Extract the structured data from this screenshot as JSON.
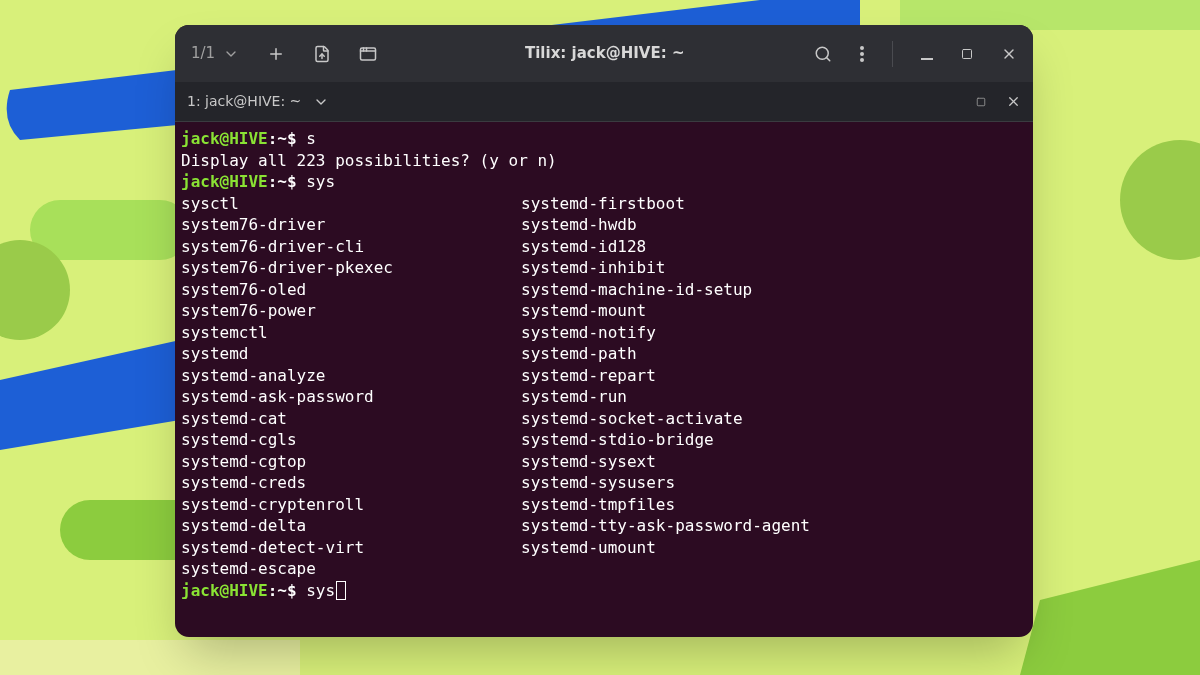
{
  "window": {
    "title": "Tilix: jack@HIVE: ~",
    "session_counter": "1/1"
  },
  "terminal_tab": {
    "title": "1: jack@HIVE: ~"
  },
  "terminal": {
    "lines": [
      {
        "kind": "prompt",
        "user_host": "jack@HIVE",
        "path": ":~$",
        "command": "s",
        "cursor": false
      },
      {
        "kind": "output",
        "text": "Display all 223 possibilities? (y or n)"
      },
      {
        "kind": "prompt",
        "user_host": "jack@HIVE",
        "path": ":~$",
        "command": "sys",
        "cursor": false
      }
    ],
    "completions": {
      "column_1": [
        "sysctl",
        "system76-driver",
        "system76-driver-cli",
        "system76-driver-pkexec",
        "system76-oled",
        "system76-power",
        "systemctl",
        "systemd",
        "systemd-analyze",
        "systemd-ask-password",
        "systemd-cat",
        "systemd-cgls",
        "systemd-cgtop",
        "systemd-creds",
        "systemd-cryptenroll",
        "systemd-delta",
        "systemd-detect-virt",
        "systemd-escape"
      ],
      "column_2": [
        "systemd-firstboot",
        "systemd-hwdb",
        "systemd-id128",
        "systemd-inhibit",
        "systemd-machine-id-setup",
        "systemd-mount",
        "systemd-notify",
        "systemd-path",
        "systemd-repart",
        "systemd-run",
        "systemd-socket-activate",
        "systemd-stdio-bridge",
        "systemd-sysext",
        "systemd-sysusers",
        "systemd-tmpfiles",
        "systemd-tty-ask-password-agent",
        "systemd-umount"
      ]
    },
    "final_prompt": {
      "kind": "prompt",
      "user_host": "jack@HIVE",
      "path": ":~$",
      "command": "sys",
      "cursor": true
    }
  }
}
